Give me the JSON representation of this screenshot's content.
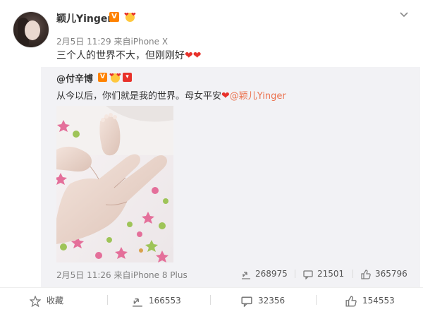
{
  "post": {
    "author": "颖儿Yinger",
    "time": "2月5日 11:29",
    "source_prefix": "来自",
    "source": "iPhone X",
    "text": "三个人的世界不大，但刚刚好",
    "text_emoji": "❤❤"
  },
  "repost": {
    "author": "@付辛博",
    "text_before": "从今以后，你们就是我的世界。母女平安",
    "text_emoji": "❤",
    "mention": "@颖儿Yinger",
    "time": "2月5日 11:26",
    "source_prefix": "来自",
    "source": "iPhone 8 Plus",
    "stats": {
      "reposts": "268975",
      "comments": "21501",
      "likes": "365796"
    }
  },
  "footer": {
    "favorite_label": "收藏",
    "reposts": "166553",
    "comments": "32356",
    "likes": "154553"
  },
  "colors": {
    "accent_orange": "#ff8200",
    "mention": "#eb7350",
    "heart": "#e8312a",
    "repost_bg": "#f2f2f5"
  },
  "icons": {
    "verified": "v-badge",
    "menu": "chevron-down-icon",
    "repost": "repost-icon",
    "comment": "comment-icon",
    "like": "thumbs-up-icon",
    "favorite": "star-icon"
  }
}
